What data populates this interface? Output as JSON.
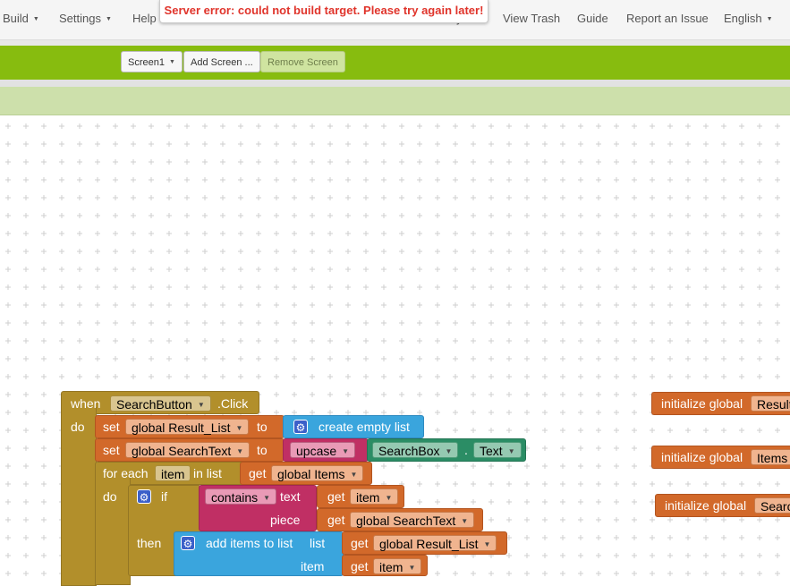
{
  "topnav": {
    "build": "Build",
    "settings": "Settings",
    "help": "Help",
    "my_projects_partial": "y",
    "view_trash": "View Trash",
    "guide": "Guide",
    "report_issue": "Report an Issue",
    "language": "English"
  },
  "error_message": "Server error: could not build target. Please try again later!",
  "designer_toolbar": {
    "screen_select": "Screen1",
    "add_screen": "Add Screen ...",
    "remove_screen": "Remove Screen"
  },
  "blocks": {
    "event": {
      "when": "when",
      "component": "SearchButton",
      "event": ".Click",
      "do": "do"
    },
    "set1": {
      "set": "set",
      "var": "global Result_List",
      "to": "to",
      "value": "create empty list"
    },
    "set2": {
      "set": "set",
      "var": "global SearchText",
      "to": "to",
      "func": "upcase",
      "component": "SearchBox",
      "dot": ".",
      "prop": "Text"
    },
    "foreach": {
      "label": "for each",
      "item": "item",
      "in_list": "in list",
      "get": "get",
      "list": "global Items",
      "do": "do"
    },
    "if_block": {
      "if": "if",
      "contains": "contains",
      "text_label": "text",
      "get": "get",
      "text_var": "item",
      "piece_label": "piece",
      "piece_var": "global SearchText",
      "then": "then"
    },
    "add_items": {
      "label": "add items to list",
      "list_label": "list",
      "get": "get",
      "list_var": "global Result_List",
      "item_label": "item",
      "item_var": "item"
    },
    "init1": {
      "label": "initialize global",
      "name": "Result_List"
    },
    "init2": {
      "label": "initialize global",
      "name": "Items"
    },
    "init3": {
      "label": "initialize global",
      "name": "SearchText"
    }
  },
  "colors": {
    "toolbar_green": "#87bc0f",
    "error_red": "#e0342b",
    "control_block": "#b28f2b",
    "variable_block": "#d2692a",
    "list_block": "#3aa5dd",
    "text_block": "#c02f64",
    "component_block": "#2b8d65"
  }
}
